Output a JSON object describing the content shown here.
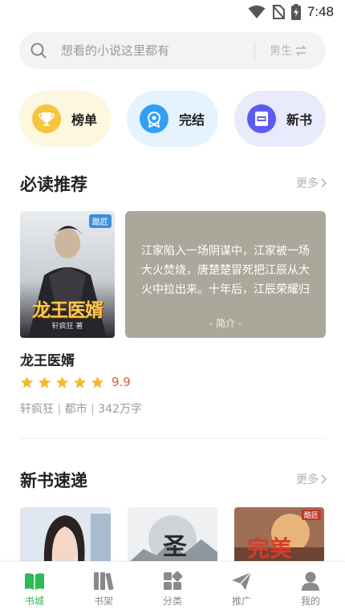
{
  "status_bar": {
    "time": "7:48"
  },
  "search": {
    "placeholder": "想看的小说这里都有",
    "gender_label": "男生"
  },
  "quick_entries": [
    {
      "label": "榜单",
      "icon": "trophy-icon",
      "bg": "#fdf7df",
      "accent": "#f5c53e"
    },
    {
      "label": "完结",
      "icon": "badge-icon",
      "bg": "#e5f3fe",
      "accent": "#32a0f2"
    },
    {
      "label": "新书",
      "icon": "new-book-icon",
      "bg": "#eaeafd",
      "accent": "#5c5cf5"
    }
  ],
  "must_read": {
    "title": "必读推荐",
    "more": "更多",
    "book": {
      "cover_title": "龙王医婿",
      "cover_author": "轩疯狂 著",
      "cover_badge": "酷匠",
      "title": "龙王医婿",
      "score": "9.9",
      "author": "轩疯狂",
      "category": "都市",
      "word_count": "342万字",
      "intro": "江家陷入一场阴谋中，江家被一场大火焚烧，唐楚楚冒死把江辰从大火中拉出来。十年后，江辰荣耀归来，报恩也报仇。报唐楚…",
      "intro_label": "- 简介 -"
    }
  },
  "new_books": {
    "title": "新书速递",
    "more": "更多",
    "covers": [
      {
        "title": ""
      },
      {
        "title": "圣"
      },
      {
        "title": "完美",
        "badge": "酷匠"
      }
    ]
  },
  "bottom_nav": [
    {
      "label": "书城",
      "icon": "book-city-icon",
      "active": true
    },
    {
      "label": "书架",
      "icon": "bookshelf-icon",
      "active": false
    },
    {
      "label": "分类",
      "icon": "category-icon",
      "active": false
    },
    {
      "label": "推广",
      "icon": "paper-plane-icon",
      "active": false
    },
    {
      "label": "我的",
      "icon": "profile-icon",
      "active": false
    }
  ],
  "colors": {
    "accent": "#2dbb55",
    "star": "#f5b82a",
    "score": "#e8553e"
  }
}
